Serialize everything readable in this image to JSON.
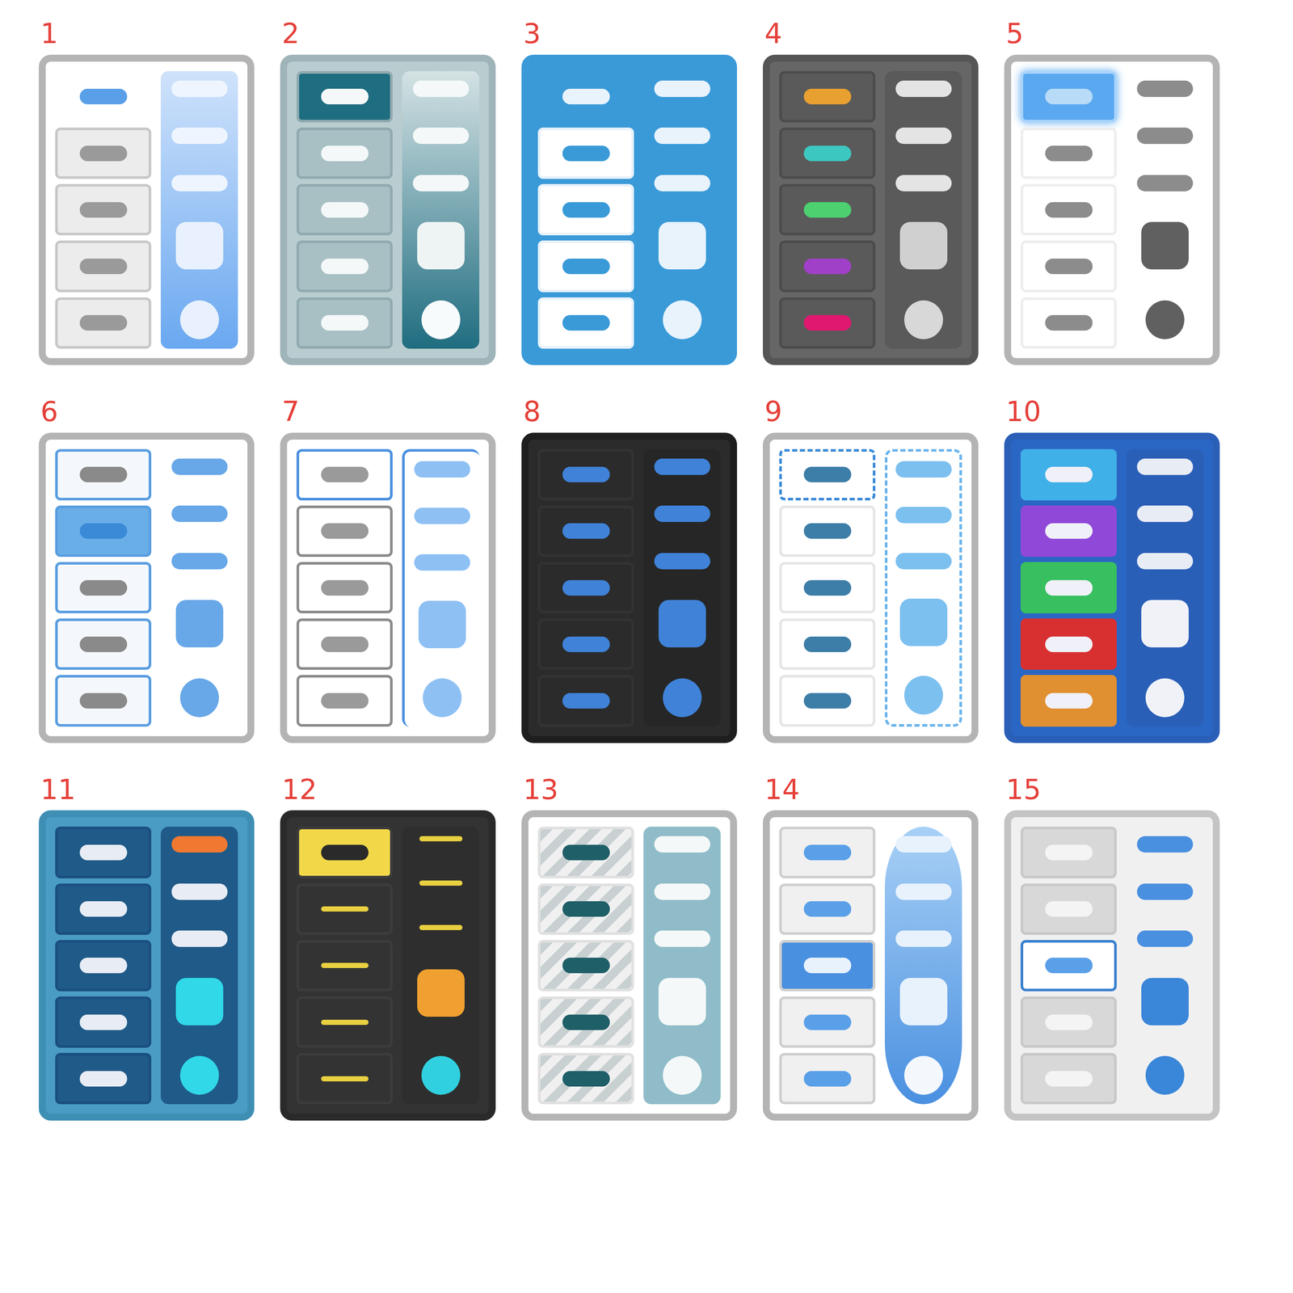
{
  "sketches": [
    {
      "label": "1",
      "kind": "sidepanel"
    },
    {
      "label": "2",
      "kind": "teal"
    },
    {
      "label": "3",
      "kind": "bluebar"
    },
    {
      "label": "4",
      "kind": "darkcolor",
      "rowColors": [
        "#e8a030",
        "#3cc8c0",
        "#4cd070",
        "#a040c8",
        "#e01870"
      ]
    },
    {
      "label": "5",
      "kind": "glow"
    },
    {
      "label": "6",
      "kind": "boxed"
    },
    {
      "label": "7",
      "kind": "outline"
    },
    {
      "label": "8",
      "kind": "dark"
    },
    {
      "label": "9",
      "kind": "brackets"
    },
    {
      "label": "10",
      "kind": "rainbow",
      "rowColors": [
        "#40b0e8",
        "#9048d8",
        "#38c060",
        "#d83030",
        "#e09030"
      ]
    },
    {
      "label": "11",
      "kind": "ocean"
    },
    {
      "label": "12",
      "kind": "yellow"
    },
    {
      "label": "13",
      "kind": "striped"
    },
    {
      "label": "14",
      "kind": "curved"
    },
    {
      "label": "15",
      "kind": "wheel"
    }
  ]
}
